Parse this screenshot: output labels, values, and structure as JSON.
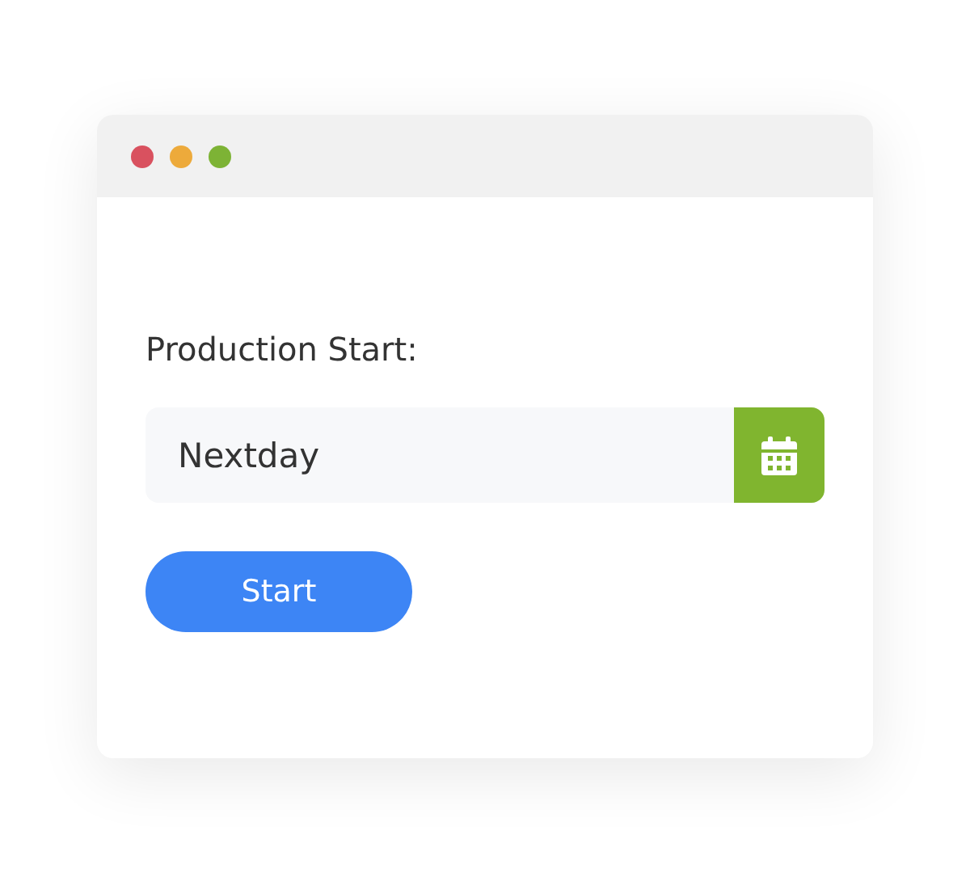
{
  "window": {
    "controls": [
      {
        "color": "#d9515f"
      },
      {
        "color": "#edaa3b"
      },
      {
        "color": "#7db335"
      }
    ]
  },
  "form": {
    "label": "Production Start:",
    "field": {
      "value": "Nextday"
    },
    "button": "Start"
  }
}
